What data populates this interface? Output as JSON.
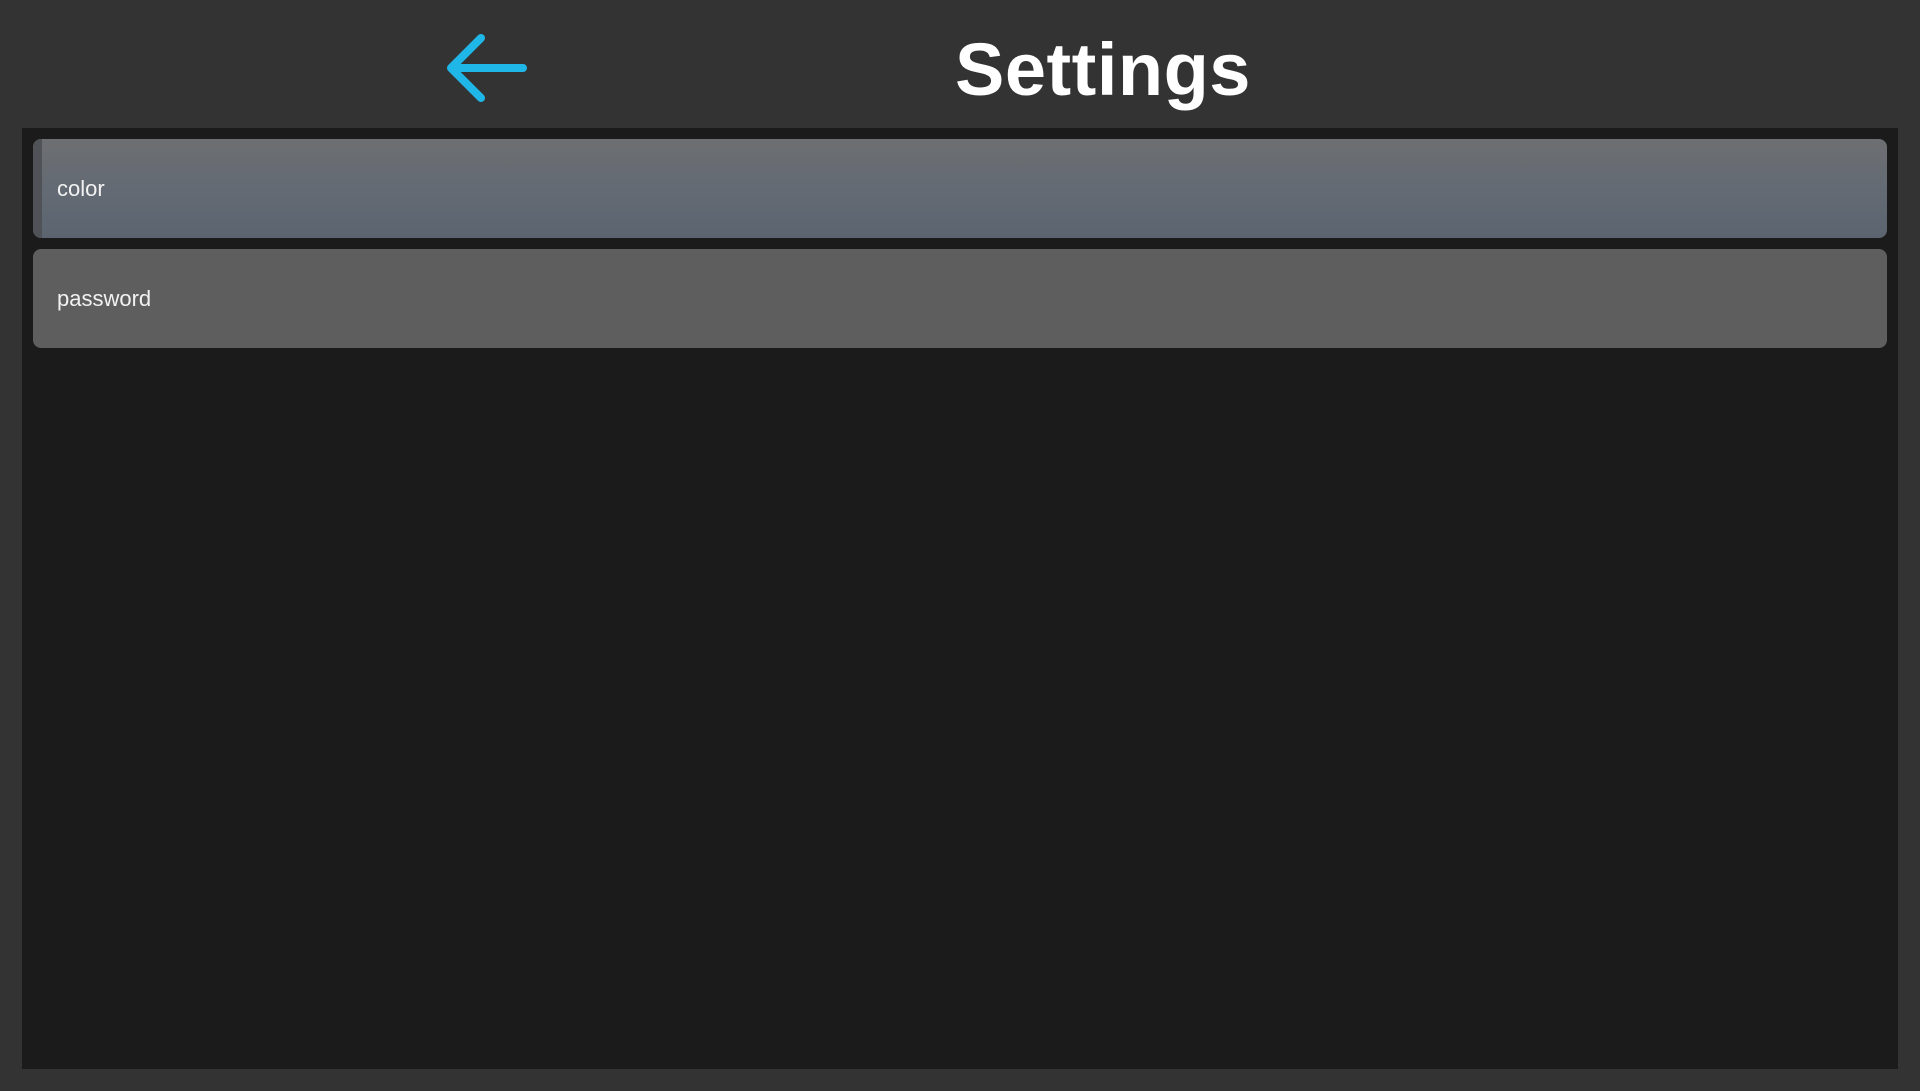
{
  "header": {
    "title": "Settings",
    "back_icon": "arrow-left-icon",
    "accent_color": "#1fb6e8"
  },
  "settings": {
    "items": [
      {
        "label": "color",
        "selected": true
      },
      {
        "label": "password",
        "selected": false
      }
    ]
  }
}
